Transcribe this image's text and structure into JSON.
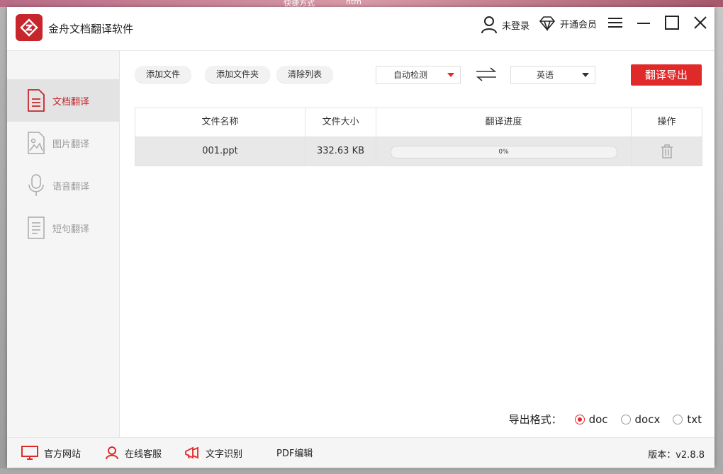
{
  "desktop": {
    "labels": [
      "快捷方式",
      "htm"
    ]
  },
  "app": {
    "title": "金舟文档翻译软件"
  },
  "titlebar": {
    "login": "未登录",
    "vip": "开通会员"
  },
  "sidebar": {
    "items": [
      {
        "label": "文档翻译",
        "icon": "document-icon",
        "active": true
      },
      {
        "label": "图片翻译",
        "icon": "image-icon",
        "active": false
      },
      {
        "label": "语音翻译",
        "icon": "microphone-icon",
        "active": false
      },
      {
        "label": "短句翻译",
        "icon": "text-page-icon",
        "active": false
      }
    ]
  },
  "toolbar": {
    "add_file": "添加文件",
    "add_folder": "添加文件夹",
    "clear_list": "清除列表",
    "source_lang": "自动检测",
    "target_lang": "英语",
    "export": "翻译导出"
  },
  "table": {
    "headers": [
      "文件名称",
      "文件大小",
      "翻译进度",
      "操作"
    ],
    "rows": [
      {
        "name": "001.ppt",
        "size": "332.63 KB",
        "progress_text": "0%",
        "progress": 0
      }
    ]
  },
  "export_format": {
    "label": "导出格式：",
    "options": [
      "doc",
      "docx",
      "txt"
    ],
    "selected": "doc"
  },
  "footer": {
    "website": "官方网站",
    "support": "在线客服",
    "ocr": "文字识别",
    "pdf": "PDF编辑",
    "version": "版本：v2.8.8"
  },
  "colors": {
    "accent": "#e02a2a",
    "brand": "#c7262d"
  }
}
